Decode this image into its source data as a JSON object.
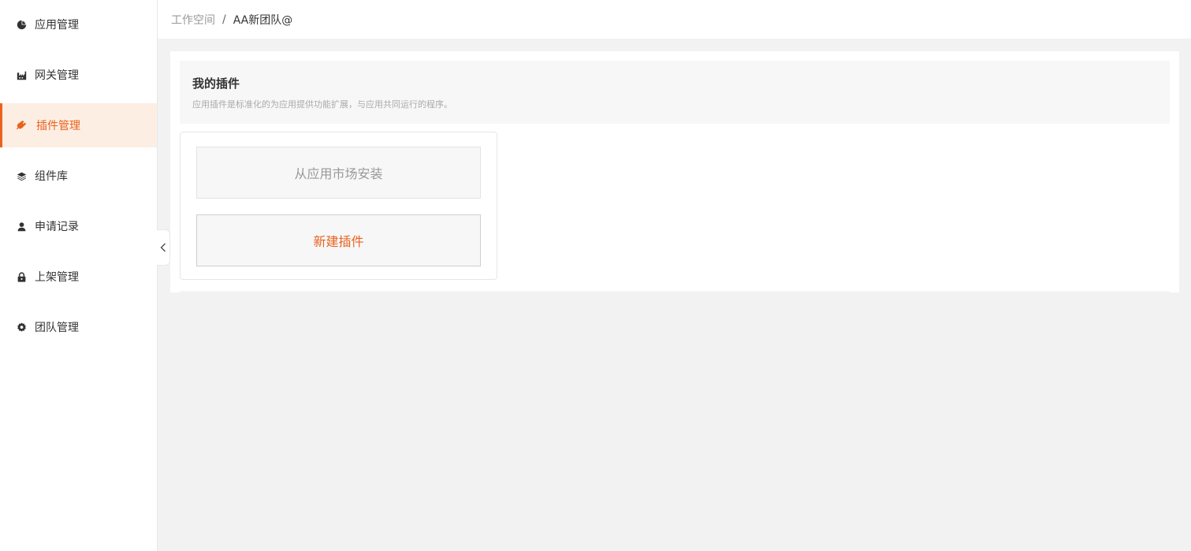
{
  "sidebar": {
    "items": [
      {
        "label": "应用管理",
        "icon": "pie-chart-icon",
        "active": false
      },
      {
        "label": "网关管理",
        "icon": "factory-icon",
        "active": false
      },
      {
        "label": "插件管理",
        "icon": "plug-icon",
        "active": true
      },
      {
        "label": "组件库",
        "icon": "layers-icon",
        "active": false
      },
      {
        "label": "申请记录",
        "icon": "user-icon",
        "active": false
      },
      {
        "label": "上架管理",
        "icon": "lock-icon",
        "active": false
      },
      {
        "label": "团队管理",
        "icon": "gear-icon",
        "active": false
      }
    ]
  },
  "breadcrumb": {
    "home": "工作空间",
    "separator": "/",
    "current": "AA新团队@"
  },
  "intro": {
    "title": "我的插件",
    "description": "应用插件是标准化的为应用提供功能扩展，与应用共同运行的程序。"
  },
  "actions": {
    "install_label": "从应用市场安装",
    "create_label": "新建插件"
  },
  "colors": {
    "accent": "#e8631e",
    "active_bg": "#fdeee3"
  }
}
